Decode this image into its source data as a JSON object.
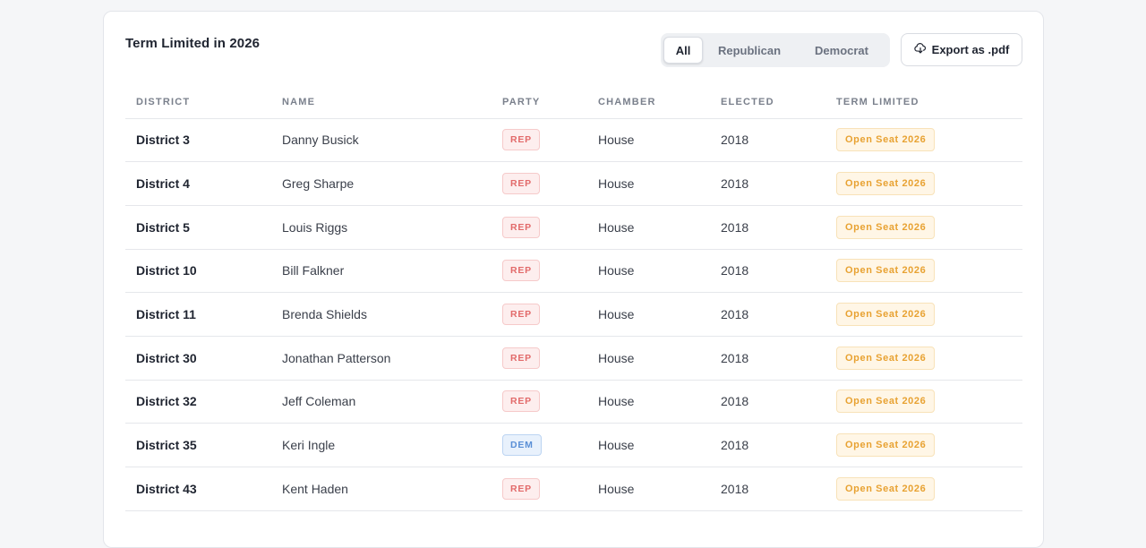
{
  "card": {
    "title": "Term Limited in 2026"
  },
  "filter": {
    "options": [
      "All",
      "Republican",
      "Democrat"
    ],
    "selected": "All"
  },
  "export": {
    "label": "Export as .pdf",
    "icon": "cloud-download-icon"
  },
  "table": {
    "headers": [
      "District",
      "Name",
      "Party",
      "Chamber",
      "Elected",
      "Term Limited"
    ],
    "rows": [
      {
        "district": "District 3",
        "name": "Danny Busick",
        "party": "REP",
        "chamber": "House",
        "elected": "2018",
        "term_limited": "Open Seat 2026"
      },
      {
        "district": "District 4",
        "name": "Greg Sharpe",
        "party": "REP",
        "chamber": "House",
        "elected": "2018",
        "term_limited": "Open Seat 2026"
      },
      {
        "district": "District 5",
        "name": "Louis Riggs",
        "party": "REP",
        "chamber": "House",
        "elected": "2018",
        "term_limited": "Open Seat 2026"
      },
      {
        "district": "District 10",
        "name": "Bill Falkner",
        "party": "REP",
        "chamber": "House",
        "elected": "2018",
        "term_limited": "Open Seat 2026"
      },
      {
        "district": "District 11",
        "name": "Brenda Shields",
        "party": "REP",
        "chamber": "House",
        "elected": "2018",
        "term_limited": "Open Seat 2026"
      },
      {
        "district": "District 30",
        "name": "Jonathan Patterson",
        "party": "REP",
        "chamber": "House",
        "elected": "2018",
        "term_limited": "Open Seat 2026"
      },
      {
        "district": "District 32",
        "name": "Jeff Coleman",
        "party": "REP",
        "chamber": "House",
        "elected": "2018",
        "term_limited": "Open Seat 2026"
      },
      {
        "district": "District 35",
        "name": "Keri Ingle",
        "party": "DEM",
        "chamber": "House",
        "elected": "2018",
        "term_limited": "Open Seat 2026"
      },
      {
        "district": "District 43",
        "name": "Kent Haden",
        "party": "REP",
        "chamber": "House",
        "elected": "2018",
        "term_limited": "Open Seat 2026"
      }
    ]
  },
  "colors": {
    "rep": "#e26a6a",
    "dem": "#5a8fd6",
    "open_seat": "#e8a232"
  }
}
